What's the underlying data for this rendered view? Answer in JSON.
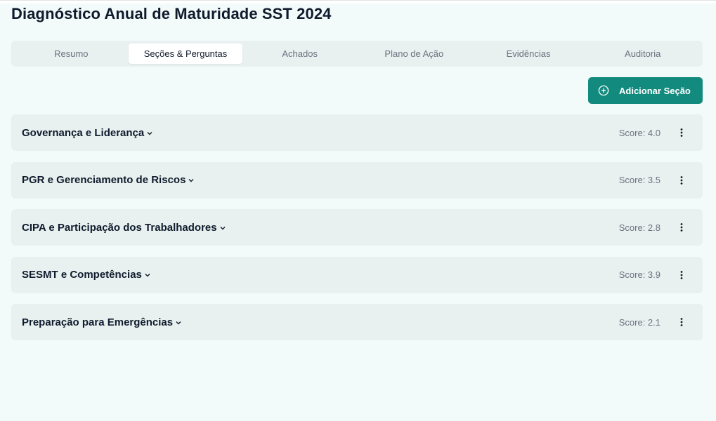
{
  "page": {
    "title": "Diagnóstico Anual de Maturidade SST 2024"
  },
  "tabs": [
    {
      "label": "Resumo",
      "active": false
    },
    {
      "label": "Seções & Perguntas",
      "active": true
    },
    {
      "label": "Achados",
      "active": false
    },
    {
      "label": "Plano de Ação",
      "active": false
    },
    {
      "label": "Evidências",
      "active": false
    },
    {
      "label": "Auditoria",
      "active": false
    }
  ],
  "actions": {
    "add_section_label": "Adicionar Seção",
    "add_section_icon": "plus-circle-icon"
  },
  "sections": [
    {
      "title": "Governança e Liderança",
      "score": "Score: 4.0"
    },
    {
      "title": "PGR e Gerenciamento de Riscos",
      "score": "Score: 3.5"
    },
    {
      "title": "CIPA e Participação dos Trabalhadores",
      "score": "Score: 2.8"
    },
    {
      "title": "SESMT e Competências",
      "score": "Score: 3.9"
    },
    {
      "title": "Preparação para Emergências",
      "score": "Score: 2.1"
    }
  ],
  "colors": {
    "accent": "#138a7e",
    "background": "#f3fbfa",
    "card": "#e8f1ef",
    "muted_text": "#6b7280"
  }
}
